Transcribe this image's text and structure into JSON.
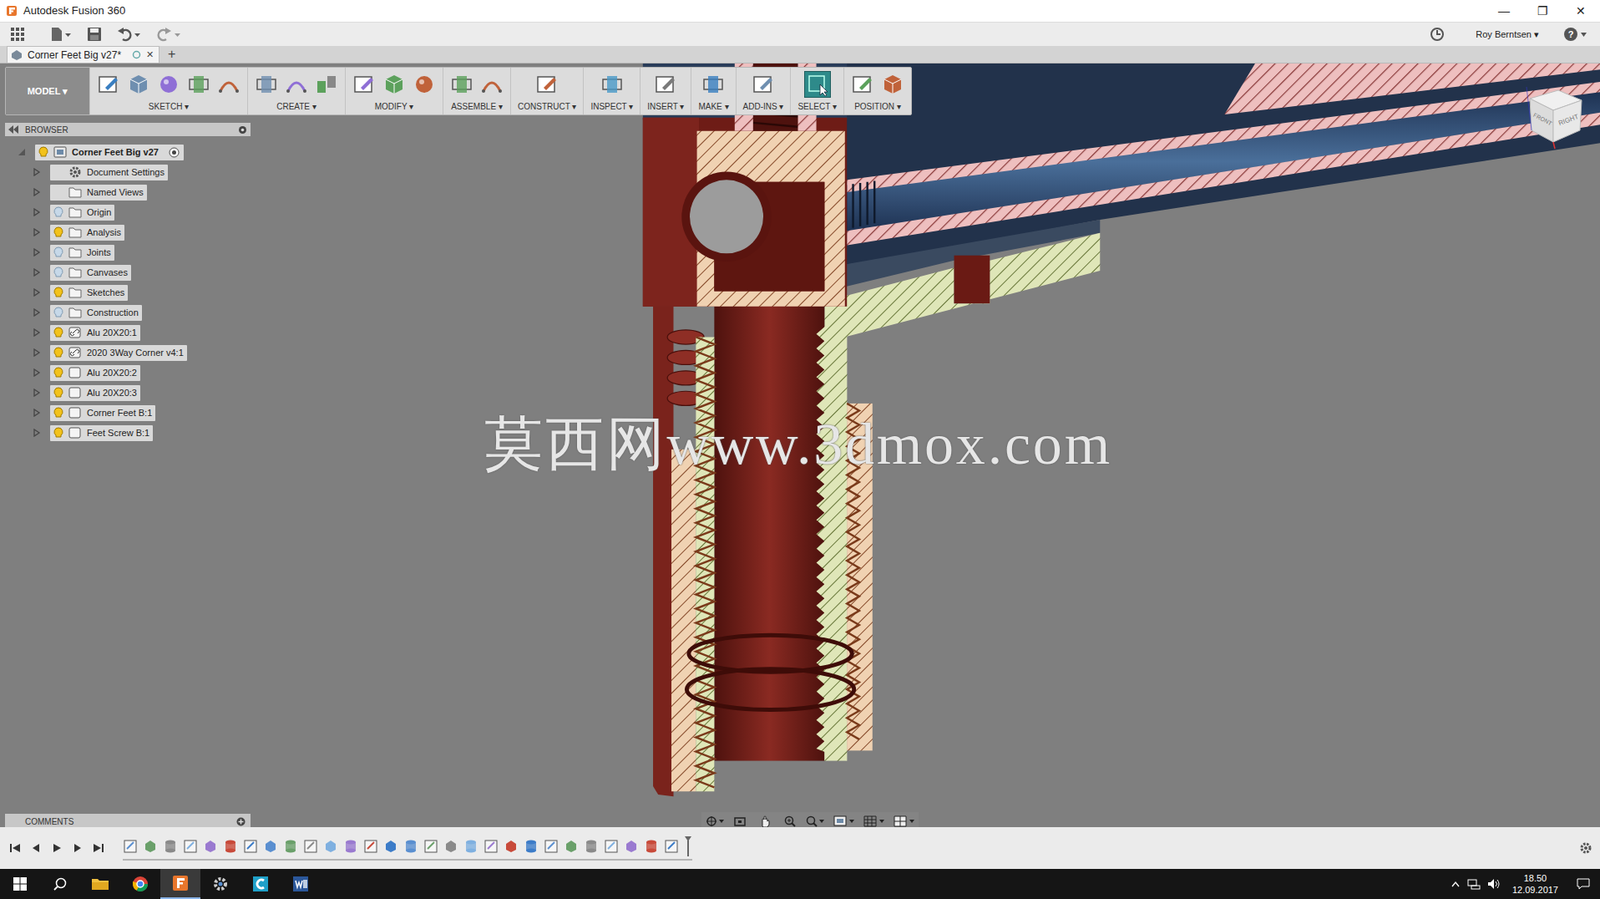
{
  "window": {
    "title": "Autodesk Fusion 360",
    "controls": [
      "—",
      "❐",
      "✕"
    ]
  },
  "quick_access": {
    "user": "Roy Berntsen ▾",
    "help": "?"
  },
  "document_tab": {
    "label": "Corner Feet Big v27*",
    "close": "✕",
    "new_tab": "+"
  },
  "toolbar": {
    "workspace": "MODEL ▾",
    "groups": [
      {
        "label": "SKETCH ▾",
        "icons": 5,
        "selected": false
      },
      {
        "label": "CREATE ▾",
        "icons": 3,
        "selected": false
      },
      {
        "label": "MODIFY ▾",
        "icons": 3,
        "selected": false
      },
      {
        "label": "ASSEMBLE ▾",
        "icons": 2,
        "selected": false
      },
      {
        "label": "CONSTRUCT ▾",
        "icons": 1,
        "selected": false
      },
      {
        "label": "INSPECT ▾",
        "icons": 1,
        "selected": false
      },
      {
        "label": "INSERT ▾",
        "icons": 1,
        "selected": false
      },
      {
        "label": "MAKE ▾",
        "icons": 1,
        "selected": false
      },
      {
        "label": "ADD-INS ▾",
        "icons": 1,
        "selected": false
      },
      {
        "label": "SELECT ▾",
        "icons": 1,
        "selected": true
      },
      {
        "label": "POSITION ▾",
        "icons": 2,
        "selected": false
      }
    ]
  },
  "browser": {
    "title": "BROWSER",
    "items": [
      {
        "label": "Corner Feet Big v27",
        "kind": "root",
        "depth": 0,
        "expanded": true,
        "visible": true
      },
      {
        "label": "Document Settings",
        "kind": "settings",
        "depth": 1,
        "expanded": false
      },
      {
        "label": "Named Views",
        "kind": "views",
        "depth": 1,
        "expanded": false
      },
      {
        "label": "Origin",
        "kind": "folder",
        "depth": 1,
        "expanded": false,
        "visible": false
      },
      {
        "label": "Analysis",
        "kind": "folder",
        "depth": 1,
        "expanded": false,
        "visible": true
      },
      {
        "label": "Joints",
        "kind": "folder",
        "depth": 1,
        "expanded": false,
        "visible": false
      },
      {
        "label": "Canvases",
        "kind": "folder",
        "depth": 1,
        "expanded": false,
        "visible": false
      },
      {
        "label": "Sketches",
        "kind": "folder",
        "depth": 1,
        "expanded": false,
        "visible": true
      },
      {
        "label": "Construction",
        "kind": "folder",
        "depth": 1,
        "expanded": false,
        "visible": false
      },
      {
        "label": "Alu 20X20:1",
        "kind": "linked",
        "depth": 1,
        "expanded": false,
        "visible": true
      },
      {
        "label": "2020 3Way Corner v4:1",
        "kind": "linked",
        "depth": 1,
        "expanded": false,
        "visible": true
      },
      {
        "label": "Alu 20X20:2",
        "kind": "component",
        "depth": 1,
        "expanded": false,
        "visible": true
      },
      {
        "label": "Alu 20X20:3",
        "kind": "component",
        "depth": 1,
        "expanded": false,
        "visible": true
      },
      {
        "label": "Corner Feet B:1",
        "kind": "component",
        "depth": 1,
        "expanded": false,
        "visible": true
      },
      {
        "label": "Feet Screw B:1",
        "kind": "component",
        "depth": 1,
        "expanded": false,
        "visible": true
      }
    ]
  },
  "comments": {
    "title": "COMMENTS"
  },
  "viewcube": {
    "faces": [
      "FRONT",
      "RIGHT"
    ]
  },
  "watermark": "莫西网www.3dmox.com",
  "timeline": {
    "feature_count": 28
  },
  "taskbar": {
    "time": "18.50",
    "date": "12.09.2017"
  }
}
